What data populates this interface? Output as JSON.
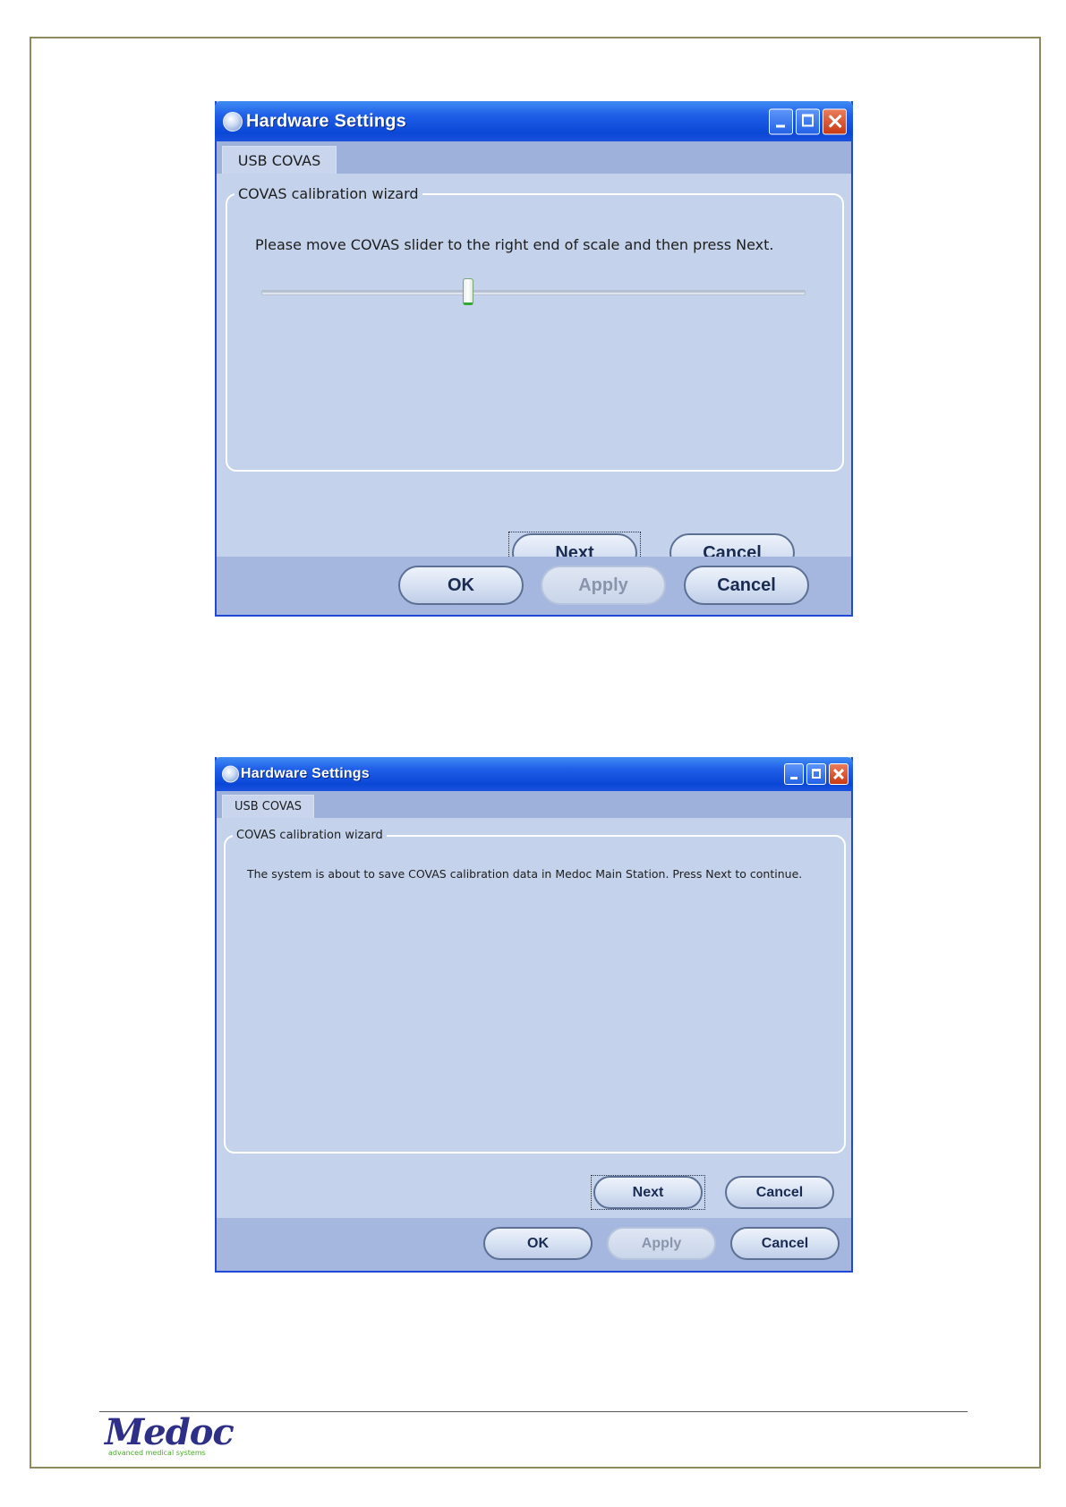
{
  "windows": [
    {
      "title": "Hardware Settings",
      "tab": "USB COVAS",
      "group_label": "COVAS calibration wizard",
      "prompt": "Please move COVAS slider to the right end of scale and then press Next.",
      "slider": {
        "value_fraction": 0.38
      },
      "wizard_buttons": {
        "next": "Next",
        "cancel": "Cancel"
      },
      "dialog_buttons": {
        "ok": "OK",
        "apply": "Apply",
        "cancel": "Cancel"
      }
    },
    {
      "title": "Hardware Settings",
      "tab": "USB COVAS",
      "group_label": "COVAS calibration wizard",
      "prompt": "The system is about to save COVAS calibration data in Medoc Main Station. Press Next to continue.",
      "wizard_buttons": {
        "next": "Next",
        "cancel": "Cancel"
      },
      "dialog_buttons": {
        "ok": "OK",
        "apply": "Apply",
        "cancel": "Cancel"
      }
    }
  ],
  "footer": {
    "logo_text": "Medoc",
    "logo_tagline": "advanced medical systems"
  },
  "colors": {
    "titlebar": "#0b47d6",
    "window_body": "#c4d3eb",
    "page_border": "#8f8a5e",
    "logo_blue": "#2e2f87",
    "logo_green": "#4aaa2a"
  }
}
